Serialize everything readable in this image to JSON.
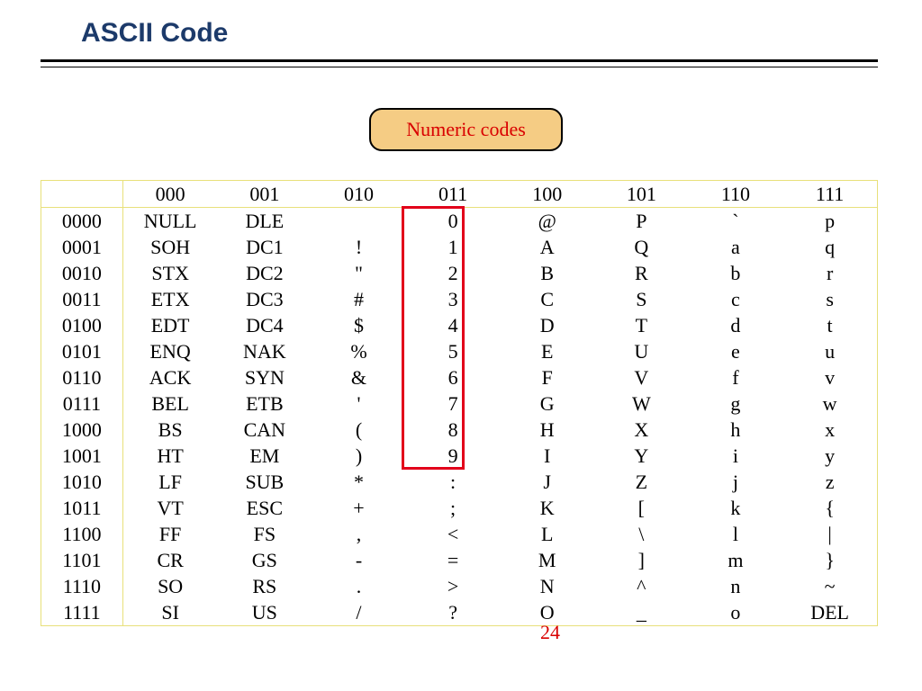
{
  "title": "ASCII Code",
  "callout": "Numeric codes",
  "page_number": "24",
  "col_headers": [
    "",
    "000",
    "001",
    "010",
    "011",
    "100",
    "101",
    "110",
    "111"
  ],
  "rows": [
    {
      "label": "0000",
      "cells": [
        "NULL",
        "DLE",
        "",
        "0",
        "@",
        "P",
        "`",
        "p"
      ]
    },
    {
      "label": "0001",
      "cells": [
        "SOH",
        "DC1",
        "!",
        "1",
        "A",
        "Q",
        "a",
        "q"
      ]
    },
    {
      "label": "0010",
      "cells": [
        "STX",
        "DC2",
        "\"",
        "2",
        "B",
        "R",
        "b",
        "r"
      ]
    },
    {
      "label": "0011",
      "cells": [
        "ETX",
        "DC3",
        "#",
        "3",
        "C",
        "S",
        "c",
        "s"
      ]
    },
    {
      "label": "0100",
      "cells": [
        "EDT",
        "DC4",
        "$",
        "4",
        "D",
        "T",
        "d",
        "t"
      ]
    },
    {
      "label": "0101",
      "cells": [
        "ENQ",
        "NAK",
        "%",
        "5",
        "E",
        "U",
        "e",
        "u"
      ]
    },
    {
      "label": "0110",
      "cells": [
        "ACK",
        "SYN",
        "&",
        "6",
        "F",
        "V",
        "f",
        "v"
      ]
    },
    {
      "label": "0111",
      "cells": [
        "BEL",
        "ETB",
        "'",
        "7",
        "G",
        "W",
        "g",
        "w"
      ]
    },
    {
      "label": "1000",
      "cells": [
        "BS",
        "CAN",
        "(",
        "8",
        "H",
        "X",
        "h",
        "x"
      ]
    },
    {
      "label": "1001",
      "cells": [
        "HT",
        "EM",
        ")",
        "9",
        "I",
        "Y",
        "i",
        "y"
      ]
    },
    {
      "label": "1010",
      "cells": [
        "LF",
        "SUB",
        "*",
        ":",
        "J",
        "Z",
        "j",
        "z"
      ]
    },
    {
      "label": "1011",
      "cells": [
        "VT",
        "ESC",
        "+",
        ";",
        "K",
        "[",
        "k",
        "{"
      ]
    },
    {
      "label": "1100",
      "cells": [
        "FF",
        "FS",
        ",",
        "<",
        "L",
        "\\",
        "l",
        "|"
      ]
    },
    {
      "label": "1101",
      "cells": [
        "CR",
        "GS",
        "-",
        "=",
        "M",
        "]",
        "m",
        "}"
      ]
    },
    {
      "label": "1110",
      "cells": [
        "SO",
        "RS",
        ".",
        ">",
        "N",
        "^",
        "n",
        "~"
      ]
    },
    {
      "label": "1111",
      "cells": [
        "SI",
        "US",
        "/",
        "?",
        "O",
        "_",
        "o",
        "DEL"
      ]
    }
  ]
}
